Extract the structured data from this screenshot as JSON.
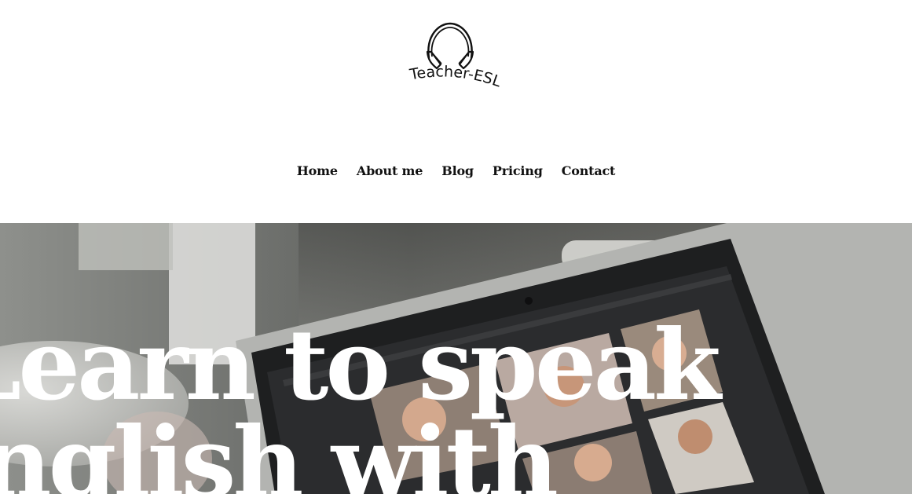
{
  "brand": {
    "name": "Teacher-ESL",
    "logo_icon": "headphones-icon"
  },
  "nav": {
    "items": [
      {
        "label": "Home"
      },
      {
        "label": "About me"
      },
      {
        "label": "Blog"
      },
      {
        "label": "Pricing"
      },
      {
        "label": "Contact"
      }
    ]
  },
  "hero": {
    "headline_line1": "Learn to speak",
    "headline_line2": "English with",
    "image": "laptop-video-call-photo",
    "colors": {
      "headline": "#ffffff"
    }
  }
}
